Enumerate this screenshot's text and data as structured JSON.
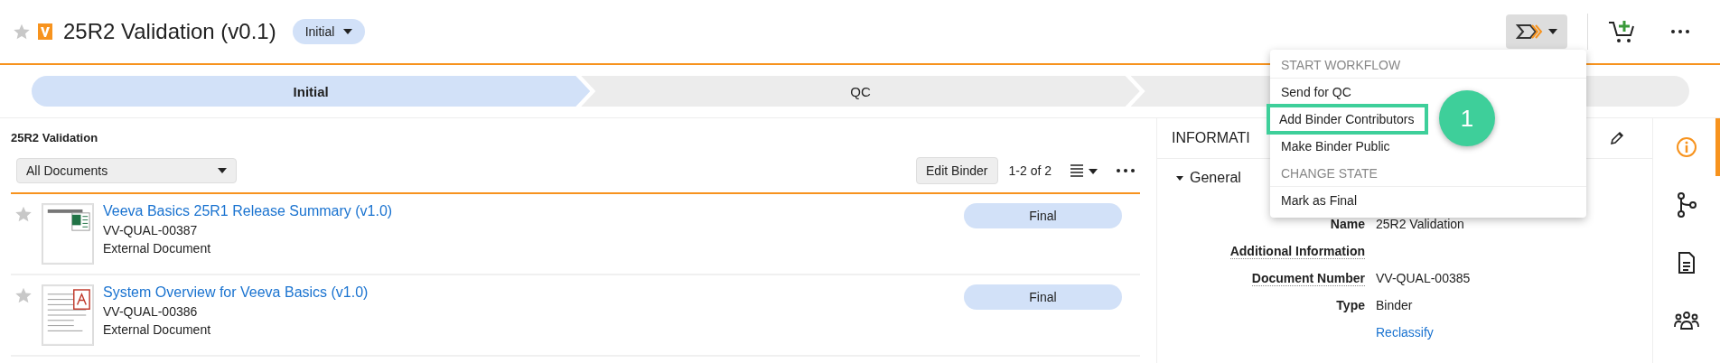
{
  "header": {
    "title": "25R2 Validation (v0.1)",
    "starred": false,
    "status": "Initial"
  },
  "stages": [
    {
      "label": "Initial",
      "selected": true
    },
    {
      "label": "QC",
      "selected": false
    },
    {
      "selected": false
    }
  ],
  "workflow_menu": {
    "sections": [
      {
        "heading": "START WORKFLOW",
        "items": [
          {
            "label": "Send for QC",
            "highlighted": false
          },
          {
            "label": "Add Binder Contributors",
            "highlighted": true
          },
          {
            "label": "Make Binder Public",
            "highlighted": false
          }
        ]
      },
      {
        "heading": "CHANGE STATE",
        "items": [
          {
            "label": "Mark as Final",
            "highlighted": false
          }
        ]
      }
    ]
  },
  "callout": {
    "number": "1"
  },
  "binder": {
    "title": "25R2 Validation",
    "filter": "All Documents",
    "edit_button": "Edit Binder",
    "count": "1-2 of 2",
    "documents": [
      {
        "title": "Veeva Basics 25R1 Release Summary (v1.0)",
        "number": "VV-QUAL-00387",
        "type": "External Document",
        "status": "Final",
        "kind": "spreadsheet",
        "starred": false
      },
      {
        "title": "System Overview for Veeva Basics (v1.0)",
        "number": "VV-QUAL-00386",
        "type": "External Document",
        "status": "Final",
        "kind": "pdf",
        "starred": false
      }
    ]
  },
  "information": {
    "heading": "INFORMATI",
    "section": "General",
    "expanded": true,
    "fields": [
      {
        "label": "Name",
        "value": "25R2 Validation",
        "help": false
      },
      {
        "label": "Additional Information",
        "help": true
      },
      {
        "label": "Document Number",
        "value": "VV-QUAL-00385",
        "help": true
      },
      {
        "label": "Type",
        "value": "Binder",
        "help": false
      }
    ],
    "link": "Reclassify"
  },
  "side_tabs": [
    {
      "kind": "info",
      "selected": true
    },
    {
      "kind": "branch",
      "selected": false
    },
    {
      "kind": "document",
      "selected": false
    },
    {
      "kind": "people",
      "selected": false
    }
  ]
}
